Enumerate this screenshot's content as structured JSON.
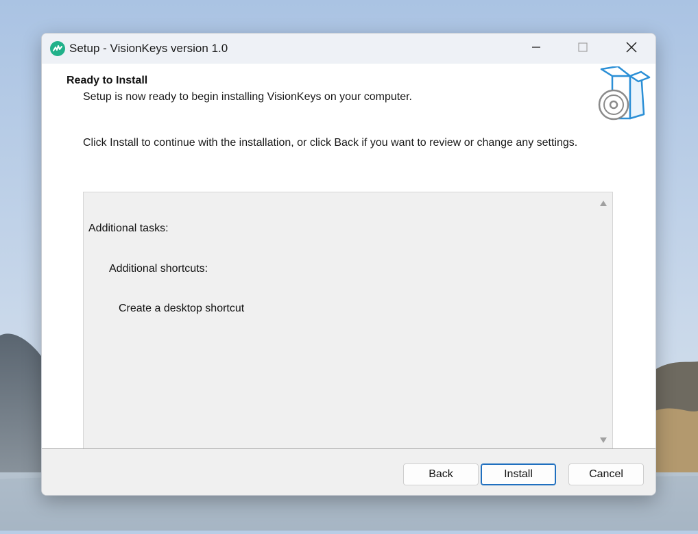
{
  "window": {
    "title": "Setup - VisionKeys version 1.0"
  },
  "page": {
    "heading": "Ready to Install",
    "subheading": "Setup is now ready to begin installing VisionKeys on your computer.",
    "instruction": "Click Install to continue with the installation, or click Back if you want to review or change any settings."
  },
  "memo": {
    "lines": [
      "Additional tasks:",
      "Additional shortcuts:",
      "Create a desktop shortcut"
    ]
  },
  "buttons": {
    "back": "Back",
    "install": "Install",
    "cancel": "Cancel"
  },
  "icons": {
    "app": "visionkeys-app-icon",
    "header": "install-box-disc-icon",
    "minimize": "minimize-icon",
    "maximize": "maximize-icon",
    "close": "close-icon"
  },
  "colors": {
    "accent": "#1f6fbf",
    "app_icon": "#21b18a",
    "header_icon": "#2b8fd6"
  }
}
